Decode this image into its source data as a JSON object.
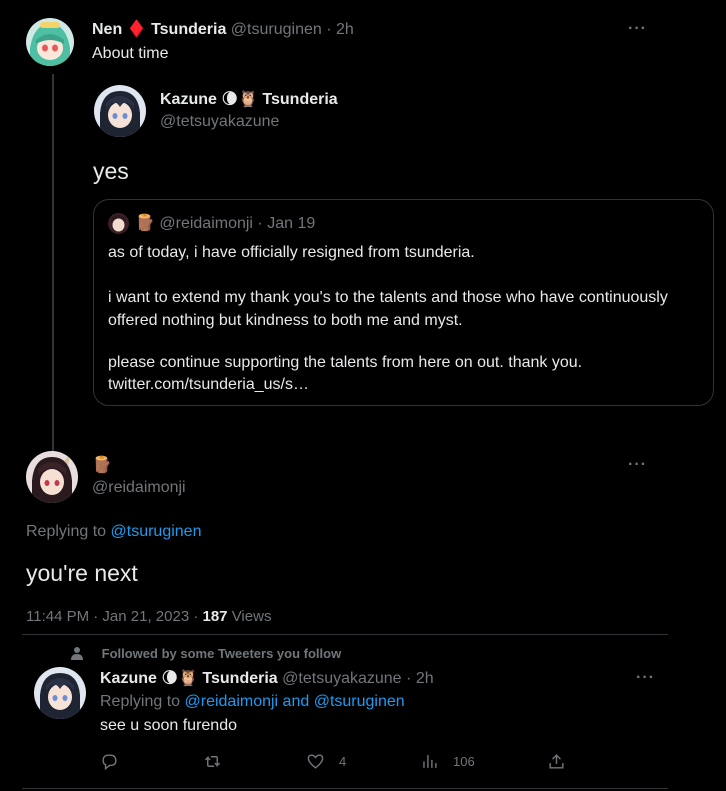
{
  "tweet1": {
    "display_name": "Nen",
    "badge_emoji": "♦️",
    "org": "Tsunderia",
    "handle": "@tsuruginen",
    "sep": "·",
    "time": "2h",
    "text": "About time",
    "more": "···"
  },
  "quoted_kazune": {
    "display_name": "Kazune",
    "badge_emojis": "🌘🦉",
    "org": "Tsunderia",
    "handle": "@tetsuyakazune",
    "text": "yes"
  },
  "nested_quote": {
    "badge_emoji": "🪵",
    "handle": "@reidaimonji",
    "sep": "·",
    "date": "Jan 19",
    "para1": "as of today, i have officially resigned from tsunderia.",
    "para2": "i want to extend my thank you's to the talents and those who have continuously offered nothing but kindness to both me and myst.",
    "para3_line1": "please continue supporting the talents from here on out. thank you.",
    "para3_line2": "twitter.com/tsunderia_us/s…"
  },
  "main_tweet": {
    "badge_emoji": "🪵",
    "handle": "@reidaimonji",
    "replying_prefix": "Replying to",
    "replying_to": "@tsuruginen",
    "text": "you're next",
    "timestamp": "11:44 PM · Jan 21, 2023 ·",
    "views_count": "187",
    "views_label": "Views",
    "more": "···"
  },
  "reply": {
    "social_context": "Followed by some Tweeters you follow",
    "display_name": "Kazune",
    "badge_emojis": "🌘🦉",
    "org": "Tsunderia",
    "handle": "@tetsuyakazune",
    "sep": "·",
    "time": "2h",
    "replying_prefix": "Replying to",
    "replying_to": "@reidaimonji and @tsuruginen",
    "text": "see u soon furendo",
    "more": "···",
    "actions": {
      "reply_icon": "reply-icon",
      "retweet_icon": "retweet-icon",
      "like_icon": "heart-icon",
      "like_count": "4",
      "views_icon": "analytics-icon",
      "views_count": "106",
      "share_icon": "share-icon"
    }
  },
  "colors": {
    "background": "#000000",
    "text": "#e7e9ea",
    "muted": "#71767b",
    "link": "#1d9bf0",
    "border": "#2f3336"
  }
}
